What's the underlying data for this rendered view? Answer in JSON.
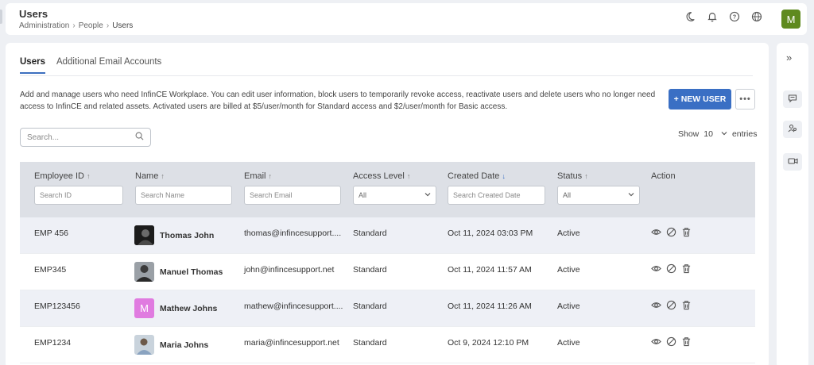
{
  "header": {
    "title": "Users",
    "breadcrumb": [
      "Administration",
      "People",
      "Users"
    ],
    "avatar_initial": "M",
    "icons": [
      "moon-icon",
      "bell-icon",
      "help-icon",
      "globe-icon"
    ]
  },
  "tabs": [
    {
      "label": "Users",
      "active": true
    },
    {
      "label": "Additional Email Accounts",
      "active": false
    }
  ],
  "description": "Add and manage users who need InfinCE Workplace. You can edit user information, block users to temporarily revoke access, reactivate users and delete users who no longer need access to InfinCE and related assets. Activated users are billed at  $5/user/month for Standard access and $2/user/month for Basic access.",
  "new_user_label": "+ NEW USER",
  "more_label": "•••",
  "search": {
    "placeholder": "Search..."
  },
  "entries": {
    "show_label": "Show",
    "value": "10",
    "entries_label": "entries"
  },
  "table": {
    "columns": [
      {
        "label": "Employee ID",
        "filter_placeholder": "Search ID"
      },
      {
        "label": "Name",
        "filter_placeholder": "Search Name"
      },
      {
        "label": "Email",
        "filter_placeholder": "Search Email"
      },
      {
        "label": "Access Level",
        "filter_value": "All"
      },
      {
        "label": "Created Date",
        "filter_placeholder": "Search Created Date"
      },
      {
        "label": "Status",
        "filter_value": "All"
      },
      {
        "label": "Action"
      }
    ],
    "rows": [
      {
        "id": "EMP 456",
        "name": "Thomas John",
        "email": "thomas@infincesupport....",
        "access": "Standard",
        "created": "Oct 11, 2024 03:03 PM",
        "status": "Active",
        "avatar": ""
      },
      {
        "id": "EMP345",
        "name": "Manuel Thomas",
        "email": "john@infincesupport.net",
        "access": "Standard",
        "created": "Oct 11, 2024 11:57 AM",
        "status": "Active",
        "avatar": ""
      },
      {
        "id": "EMP123456",
        "name": "Mathew Johns",
        "email": "mathew@infincesupport....",
        "access": "Standard",
        "created": "Oct 11, 2024 11:26 AM",
        "status": "Active",
        "avatar": "M"
      },
      {
        "id": "EMP1234",
        "name": "Maria Johns",
        "email": "maria@infincesupport.net",
        "access": "Standard",
        "created": "Oct 9, 2024 12:10 PM",
        "status": "Active",
        "avatar": ""
      }
    ]
  },
  "colors": {
    "accent": "#3a6fc4",
    "avatar_green": "#5f8a1f",
    "avatar_pink": "#e07be0"
  }
}
